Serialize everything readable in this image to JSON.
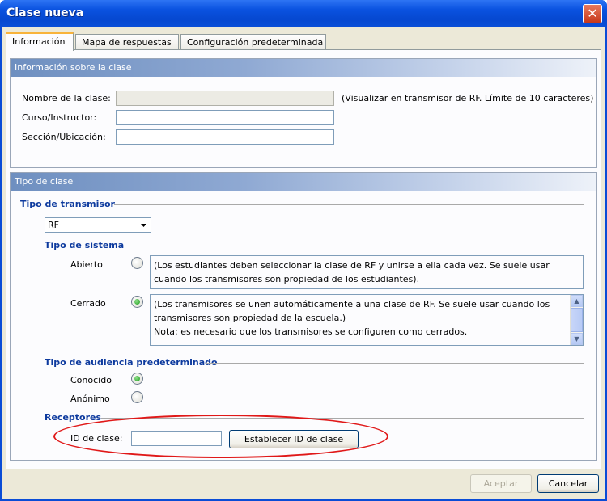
{
  "window": {
    "title": "Clase nueva",
    "close_glyph": "✕"
  },
  "tabs": [
    {
      "label": "Información"
    },
    {
      "label": "Mapa de respuestas"
    },
    {
      "label": "Configuración predeterminada"
    }
  ],
  "class_info": {
    "header": "Información sobre la clase",
    "name_label": "Nombre de la clase:",
    "name_value": "",
    "name_hint": "(Visualizar en transmisor de RF. Límite de 10 caracteres)",
    "course_label": "Curso/Instructor:",
    "course_value": "",
    "section_label": "Sección/Ubicación:",
    "section_value": ""
  },
  "class_type": {
    "header": "Tipo de clase",
    "transmitter_title": "Tipo de transmisor",
    "transmitter_value": "RF",
    "system_title": "Tipo de sistema",
    "open_label": "Abierto",
    "open_desc": "(Los estudiantes deben seleccionar la clase de RF y unirse a ella cada vez. Se suele usar cuando los transmisores son propiedad de los estudiantes).",
    "closed_label": "Cerrado",
    "closed_desc_1": "(Los transmisores se unen automáticamente a una clase de RF. Se suele usar cuando los transmisores son propiedad de la escuela.)",
    "closed_desc_2": "Nota: es necesario que los transmisores se configuren como cerrados.",
    "audience_title": "Tipo de audiencia predeterminado",
    "known_label": "Conocido",
    "anon_label": "Anónimo",
    "receivers_title": "Receptores",
    "class_id_label": "ID de clase:",
    "class_id_value": "",
    "set_id_button": "Establecer ID de clase"
  },
  "footer": {
    "accept": "Aceptar",
    "cancel": "Cancelar"
  },
  "colors": {
    "title_bar": "#0a52e0",
    "section_title": "#0d3a9e",
    "annotation": "#e01818",
    "selected_radio": "#1d9a1d"
  },
  "state": {
    "system_selected": "Cerrado",
    "audience_selected": "Conocido"
  }
}
